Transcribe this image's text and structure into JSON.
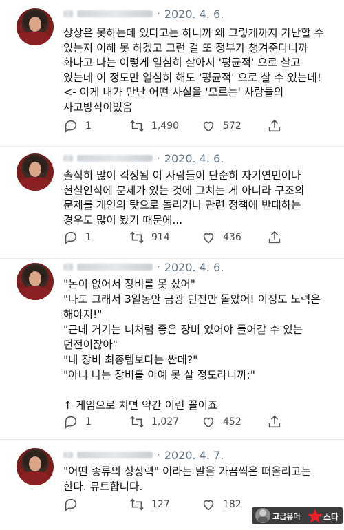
{
  "tweets": [
    {
      "date": "2020. 4. 6.",
      "text": "상상은 못하는데 있다고는 하니까 왜 그렇게까지 가난할 수 있는지 이해 못 하겠고 그런 걸 또 정부가 챙겨준다니까 화나고 나는 이렇게 열심히 살아서 '평균적' 으로 살고 있는데 이 정도만 열심히 해도 '평균적' 으로 살 수 있는데! <- 이게 내가 만난 어떤 사실을 '모르는' 사람들의 사고방식이었음",
      "replies": "1",
      "retweets": "1,490",
      "likes": "572"
    },
    {
      "date": "2020. 4. 6.",
      "text": "솔식히 많이 걱정됨 이 사람들이 단순히 자기연민이나 현실인식에 문제가 있는 것에 그치는 게 아니라 구조의 문제를 개인의 탓으로 돌리거나 관련 정책에 반대하는 경우도 많이 봤기 때문에...",
      "replies": "1",
      "retweets": "914",
      "likes": "436"
    },
    {
      "date": "2020. 4. 6.",
      "text": "\"논이 없어서 장비를 못 샀어\"\n\"나도 그래서 3일동안 금광 던전만 돌았어! 이정도 노력은 해야지!\"\n\"근데 거기는 너처럼 좋은 장비 있어야 들어갈 수 있는 던전이잖아\"\n\"내 장비 최종템보다는 싼데?\"\n\"아니 나는 장비를 아예 못 살 정도라니까;\"\n\n↑ 게임으로 치면 약간 이런 꼴이죠",
      "replies": "1",
      "retweets": "1,027",
      "likes": "452"
    },
    {
      "date": "2020. 4. 7.",
      "text": "\"어떤 종류의 상상력\" 이라는 말을 가끔씩은 떠올리고는 한다. 뮤트합니다.",
      "replies": "",
      "retweets": "127",
      "likes": "182"
    }
  ],
  "watermark": {
    "text": "고급유머 ★ 스타",
    "colors": {
      "accent": "#e8202a",
      "text": "#ffffff",
      "bg": "#1a1a1a"
    }
  },
  "colors": {
    "text": "#14171a",
    "muted": "#657786",
    "divider": "#e6ecf0"
  },
  "icons": [
    "reply-icon",
    "retweet-icon",
    "like-icon",
    "share-icon"
  ]
}
